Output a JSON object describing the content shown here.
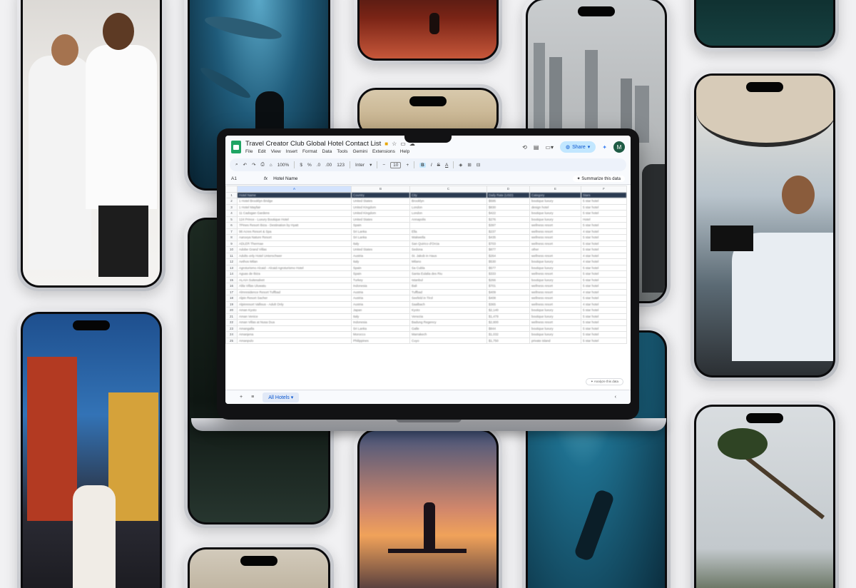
{
  "sheet": {
    "title": "Travel Creator Club Global Hotel Contact List",
    "menu": [
      "File",
      "Edit",
      "View",
      "Insert",
      "Format",
      "Data",
      "Tools",
      "Gemini",
      "Extensions",
      "Help"
    ],
    "share_label": "Share",
    "avatar_initial": "M",
    "toolbar": {
      "zoom": "100%",
      "currency": "$",
      "percent": "%",
      "dec_less": ".0",
      "dec_more": ".00",
      "num_format": "123",
      "font": "Inter",
      "font_size": "10",
      "bold": "B",
      "italic": "I",
      "strike": "S",
      "text_color": "A"
    },
    "name_box": "A1",
    "formula_value": "Hotel Name",
    "summarize_label": "Summarize this data",
    "columns": [
      "A",
      "B",
      "C",
      "D",
      "E",
      "F"
    ],
    "header_row": [
      "Hotel Name",
      "Country",
      "City",
      "Daily Rate (USD)",
      "Category",
      "Stars"
    ],
    "rows": [
      [
        "1 Hotel Brooklyn Bridge",
        "United States",
        "Brooklyn",
        "$595",
        "boutique luxury",
        "5 star hotel"
      ],
      [
        "1 Hotel Mayfair",
        "United Kingdom",
        "London",
        "$830",
        "design hotel",
        "5 star hotel"
      ],
      [
        "11 Cadogan Gardens",
        "United Kingdom",
        "London",
        "$422",
        "boutique luxury",
        "5 star hotel"
      ],
      [
        "124 Prince - Luxury Boutique Hotel",
        "United States",
        "Annapolis",
        "$276",
        "boutique luxury",
        "Hotel"
      ],
      [
        "7Pines Resort Ibiza - Destination by Hyatt",
        "Spain",
        "",
        "$397",
        "wellness resort",
        "5 star hotel"
      ],
      [
        "98 Acres Resort & Spa",
        "Sri Lanka",
        "Ella",
        "$237",
        "wellness resort",
        "4 star hotel"
      ],
      [
        "Aaruvya Nature Resort",
        "Sri Lanka",
        "Wakwella",
        "$435",
        "wellness resort",
        "5 star hotel"
      ],
      [
        "ADLER Thermae",
        "Italy",
        "San Quirico d'Orcia",
        "$703",
        "wellness resort",
        "5 star hotel"
      ],
      [
        "Adobe Grand Villas",
        "United States",
        "Sedona",
        "$877",
        "other",
        "5 star hotel"
      ],
      [
        "Adults only Hotel Unterschwer",
        "Austria",
        "St. Jakob in Haus",
        "$264",
        "wellness resort",
        "4 star hotel"
      ],
      [
        "Aethos Milan",
        "Italy",
        "Milano",
        "$530",
        "boutique luxury",
        "4 star hotel"
      ],
      [
        "Agroturismo Alcaid - Alcaid Agroturismo Hotel",
        "Spain",
        "Sa Cubla",
        "$577",
        "boutique luxury",
        "5 star hotel"
      ],
      [
        "Aguas de Ibiza",
        "Spain",
        "Santa Eulalia des Riu",
        "$333",
        "wellness resort",
        "5 star hotel"
      ],
      [
        "ALAIA Suitesalvet",
        "Turkey",
        "Istanbul",
        "$266",
        "boutique luxury",
        "5 star hotel"
      ],
      [
        "Alila Villas Uluwatu",
        "Indonesia",
        "Bali",
        "$701",
        "wellness resort",
        "5 star hotel"
      ],
      [
        "Almresidence Resort Tuffbad",
        "Austria",
        "Tuffbad",
        "$409",
        "wellness resort",
        "4 star hotel"
      ],
      [
        "Alpin Resort Sacher",
        "Austria",
        "Seefeld in Tirol",
        "$408",
        "wellness resort",
        "5 star hotel"
      ],
      [
        "Alpinresort Vallisus - Adult Only",
        "Austria",
        "Saalbach",
        "$365",
        "wellness resort",
        "4 star hotel"
      ],
      [
        "Aman Kyoto",
        "Japan",
        "Kyoto",
        "$2,140",
        "boutique luxury",
        "5 star hotel"
      ],
      [
        "Aman Venice",
        "Italy",
        "Venezia",
        "$1,479",
        "boutique luxury",
        "5 star hotel"
      ],
      [
        "Aman Villas at Nusa Dua",
        "Indonesia",
        "Badung Regency",
        "$2,800",
        "wellness resort",
        "5 star hotel"
      ],
      [
        "Amangalla",
        "Sri Lanka",
        "Galle",
        "$844",
        "boutique luxury",
        "5 star hotel"
      ],
      [
        "Amanjena",
        "Morocco",
        "Marrakech",
        "$1,032",
        "boutique luxury",
        "5 star hotel"
      ],
      [
        "Amanpulo",
        "Philippines",
        "Cuyo",
        "$1,750",
        "private island",
        "5 star hotel"
      ]
    ],
    "analyze_label": "Analyze this data",
    "tab_label": "All Hotels",
    "add_sheet": "+",
    "sheets_list": "≡",
    "scroll_right": "‹"
  }
}
